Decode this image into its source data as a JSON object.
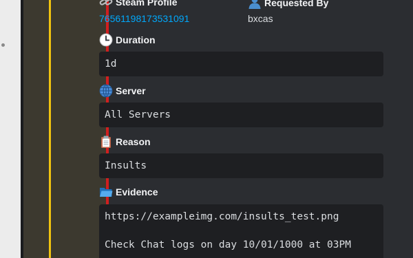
{
  "fields": {
    "steam_profile": {
      "label": "Steam Profile",
      "value": "76561198173531091"
    },
    "requested_by": {
      "label": "Requested By",
      "value": "bxcas"
    },
    "duration": {
      "label": "Duration",
      "value": "1d"
    },
    "server": {
      "label": "Server",
      "value": "All Servers"
    },
    "reason": {
      "label": "Reason",
      "value": "Insults"
    },
    "evidence": {
      "label": "Evidence",
      "lines": [
        "https://exampleimg.com/insults_test.png",
        "Check Chat logs on day 10/01/1000 at 03PM"
      ]
    }
  },
  "icons": {
    "steam_profile": "link-icon",
    "requested_by": "user-silhouette-icon",
    "duration": "clock-icon",
    "server": "globe-icon",
    "reason": "clipboard-icon",
    "evidence": "folder-icon"
  },
  "colors": {
    "embed_accent": "#d01f1f",
    "highlight_bar": "#f1c40f",
    "link": "#00a8fc",
    "code_background": "#1e1f22",
    "embed_background": "#2b2d31"
  }
}
